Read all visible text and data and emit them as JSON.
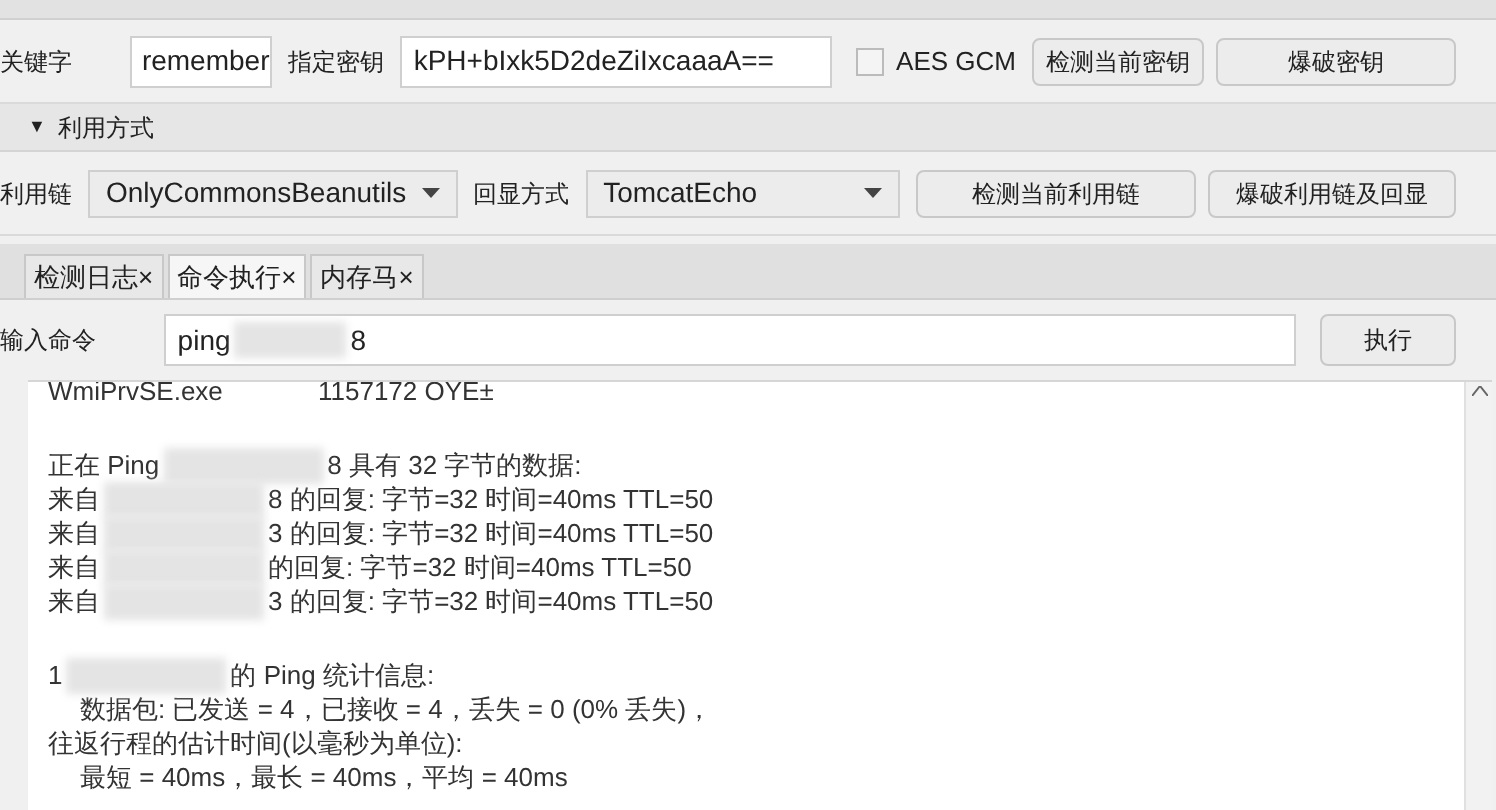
{
  "key_row": {
    "keyword_label": "关键字",
    "keyword_value": "remember",
    "key_label": "指定密钥",
    "key_value": "kPH+bIxk5D2deZiIxcaaaA==",
    "aes_gcm": {
      "label": "AES GCM",
      "checked": false
    },
    "buttons": [
      "检测当前密钥",
      "爆破密钥"
    ]
  },
  "exploit_section": {
    "title": "利用方式",
    "expanded": true,
    "toggle": "▼"
  },
  "chain_row": {
    "chain_label": "利用链",
    "chain_value": "OnlyCommonsBeanutils",
    "echo_label": "回显方式",
    "echo_value": "TomcatEcho",
    "buttons": [
      "检测当前利用链",
      "爆破利用链及回显"
    ]
  },
  "tabs": [
    {
      "label": "检测日志",
      "close": "×",
      "selected": false
    },
    {
      "label": "命令执行",
      "close": "×",
      "selected": true
    },
    {
      "label": "内存马",
      "close": "×",
      "selected": false
    }
  ],
  "command_row": {
    "label": "输入命令",
    "value_start": "ping",
    "value_end": "8",
    "button": "执行"
  },
  "output_lines": [
    {
      "kind": "text",
      "parts": [
        "WmiPrvSE.exe",
        "1157172 OYE±"
      ]
    },
    {
      "kind": "blank"
    },
    {
      "kind": "text",
      "parts": [
        "正在 Ping",
        "8 具有 32 字节的数据:"
      ]
    },
    {
      "kind": "text",
      "parts": [
        "来自",
        "8 的回复: 字节=32 时间=40ms TTL=50"
      ]
    },
    {
      "kind": "text",
      "parts": [
        "来自",
        "3 的回复: 字节=32 时间=40ms TTL=50"
      ]
    },
    {
      "kind": "text",
      "parts": [
        "来自",
        "的回复: 字节=32 时间=40ms TTL=50"
      ]
    },
    {
      "kind": "text",
      "parts": [
        "来自",
        "3 的回复: 字节=32 时间=40ms TTL=50"
      ]
    },
    {
      "kind": "blank"
    },
    {
      "kind": "text",
      "parts": [
        "1",
        "的 Ping 统计信息:"
      ]
    },
    {
      "kind": "indent",
      "parts": [
        "数据包: 已发送 = 4，已接收 = 4，丢失 = 0 (0% 丢失)，"
      ]
    },
    {
      "kind": "text",
      "parts": [
        "往返行程的估计时间(以毫秒为单位):"
      ]
    },
    {
      "kind": "indent",
      "parts": [
        "最短 = 40ms，最长 = 40ms，平均 = 40ms"
      ]
    }
  ]
}
